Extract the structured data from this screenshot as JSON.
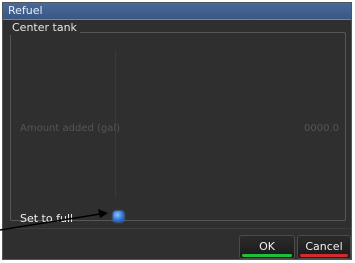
{
  "window": {
    "title": "Refuel"
  },
  "group": {
    "legend": "Center tank"
  },
  "amount": {
    "label": "Amount added (gal)",
    "value": "0000.0"
  },
  "set_to_full": {
    "label": "Set to full",
    "checked": true
  },
  "buttons": {
    "ok_label": "OK",
    "cancel_label": "Cancel"
  },
  "colors": {
    "title_bar": "#3a5784",
    "ok_accent": "#1fbf3a",
    "cancel_accent": "#d42a2a",
    "checkbox": "#2e74d8"
  },
  "icons": {
    "checkbox": "checked-checkbox-icon",
    "pointer": "callout-arrow-icon"
  }
}
